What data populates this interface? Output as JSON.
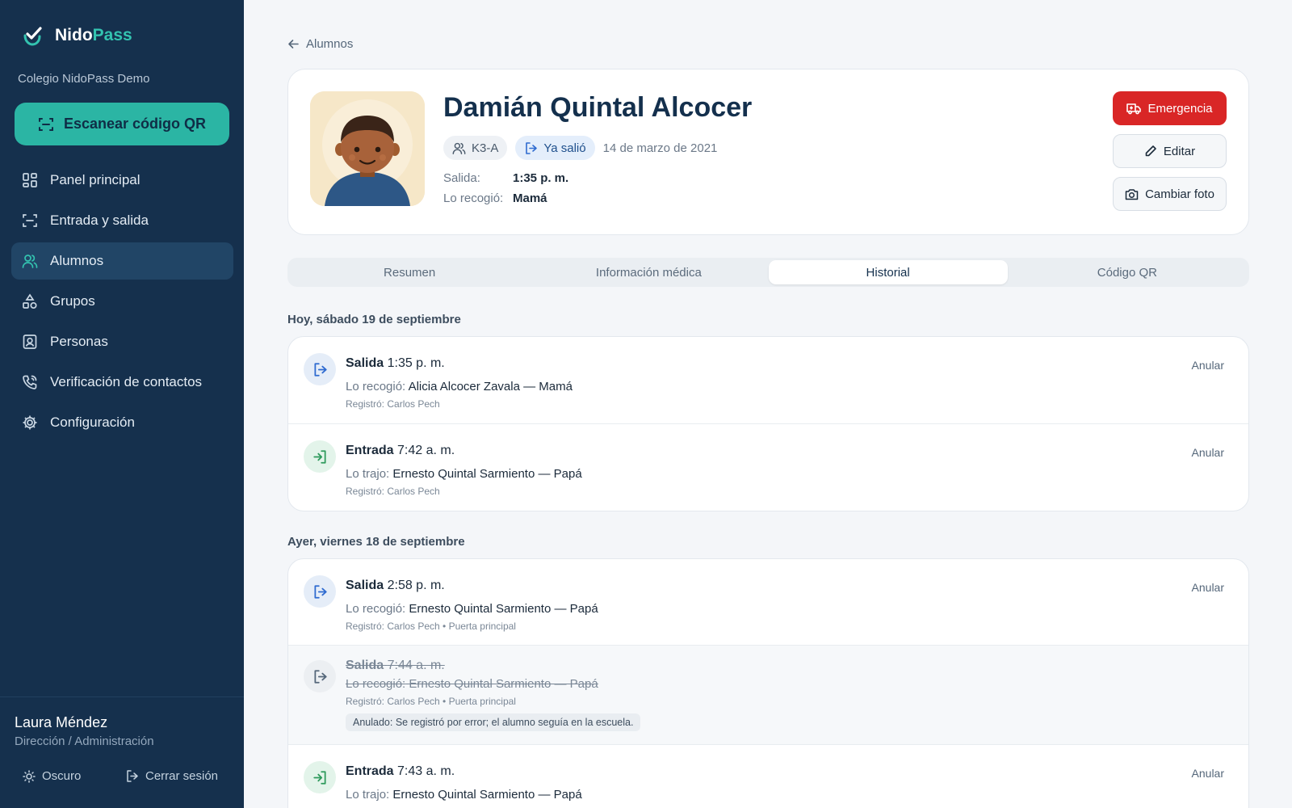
{
  "brand": {
    "name_part1": "Nido",
    "name_part2": "Pass"
  },
  "school": "Colegio NidoPass Demo",
  "scan_button": "Escanear código QR",
  "nav": [
    {
      "label": "Panel principal",
      "icon": "dashboard-icon"
    },
    {
      "label": "Entrada y salida",
      "icon": "scan-icon"
    },
    {
      "label": "Alumnos",
      "icon": "users-icon",
      "active": true
    },
    {
      "label": "Grupos",
      "icon": "shapes-icon"
    },
    {
      "label": "Personas",
      "icon": "contact-icon"
    },
    {
      "label": "Verificación de contactos",
      "icon": "phone-icon"
    },
    {
      "label": "Configuración",
      "icon": "gear-icon"
    }
  ],
  "user": {
    "name": "Laura Méndez",
    "role": "Dirección / Administración"
  },
  "footer": {
    "theme": "Oscuro",
    "logout": "Cerrar sesión"
  },
  "back_link": "Alumnos",
  "student": {
    "name": "Damián Quintal Alcocer",
    "group": "K3-A",
    "status": "Ya salió",
    "birth_date": "14 de marzo de 2021",
    "exit_label": "Salida:",
    "exit_time": "1:35 p. m.",
    "picked_label": "Lo recogió:",
    "picked_by": "Mamá"
  },
  "actions": {
    "emergency": "Emergencia",
    "edit": "Editar",
    "change_photo": "Cambiar foto"
  },
  "tabs": [
    "Resumen",
    "Información médica",
    "Historial",
    "Código QR"
  ],
  "active_tab": "Historial",
  "history": {
    "today": {
      "heading": "Hoy, sábado 19 de septiembre",
      "events": [
        {
          "type": "Salida",
          "time": "1:35 p. m.",
          "who_label": "Lo recogió:",
          "who": "Alicia Alcocer Zavala — Mamá",
          "registered": "Registró: Carlos Pech",
          "action": "Anular"
        },
        {
          "type": "Entrada",
          "time": "7:42 a. m.",
          "who_label": "Lo trajo:",
          "who": "Ernesto Quintal Sarmiento — Papá",
          "registered": "Registró: Carlos Pech",
          "action": "Anular"
        }
      ]
    },
    "yesterday": {
      "heading": "Ayer, viernes 18 de septiembre",
      "events": [
        {
          "type": "Salida",
          "time": "2:58 p. m.",
          "who_label": "Lo recogió:",
          "who": "Ernesto Quintal Sarmiento — Papá",
          "registered": "Registró: Carlos Pech • Puerta principal",
          "action": "Anular"
        },
        {
          "type": "Salida",
          "time": "7:44 a. m.",
          "who_label": "Lo recogió:",
          "who": "Ernesto Quintal Sarmiento — Papá",
          "registered": "Registró: Carlos Pech • Puerta principal",
          "void_note": "Anulado: Se registró por error; el alumno seguía en la escuela."
        },
        {
          "type": "Entrada",
          "time": "7:43 a. m.",
          "who_label": "Lo trajo:",
          "who": "Ernesto Quintal Sarmiento — Papá",
          "action": "Anular"
        }
      ]
    }
  },
  "colors": {
    "sidebar": "#15304d",
    "accent": "#2bb5a4",
    "emergency": "#d92626",
    "exit_icon": "#2f6bd0",
    "entry_icon": "#2e9a5c"
  }
}
